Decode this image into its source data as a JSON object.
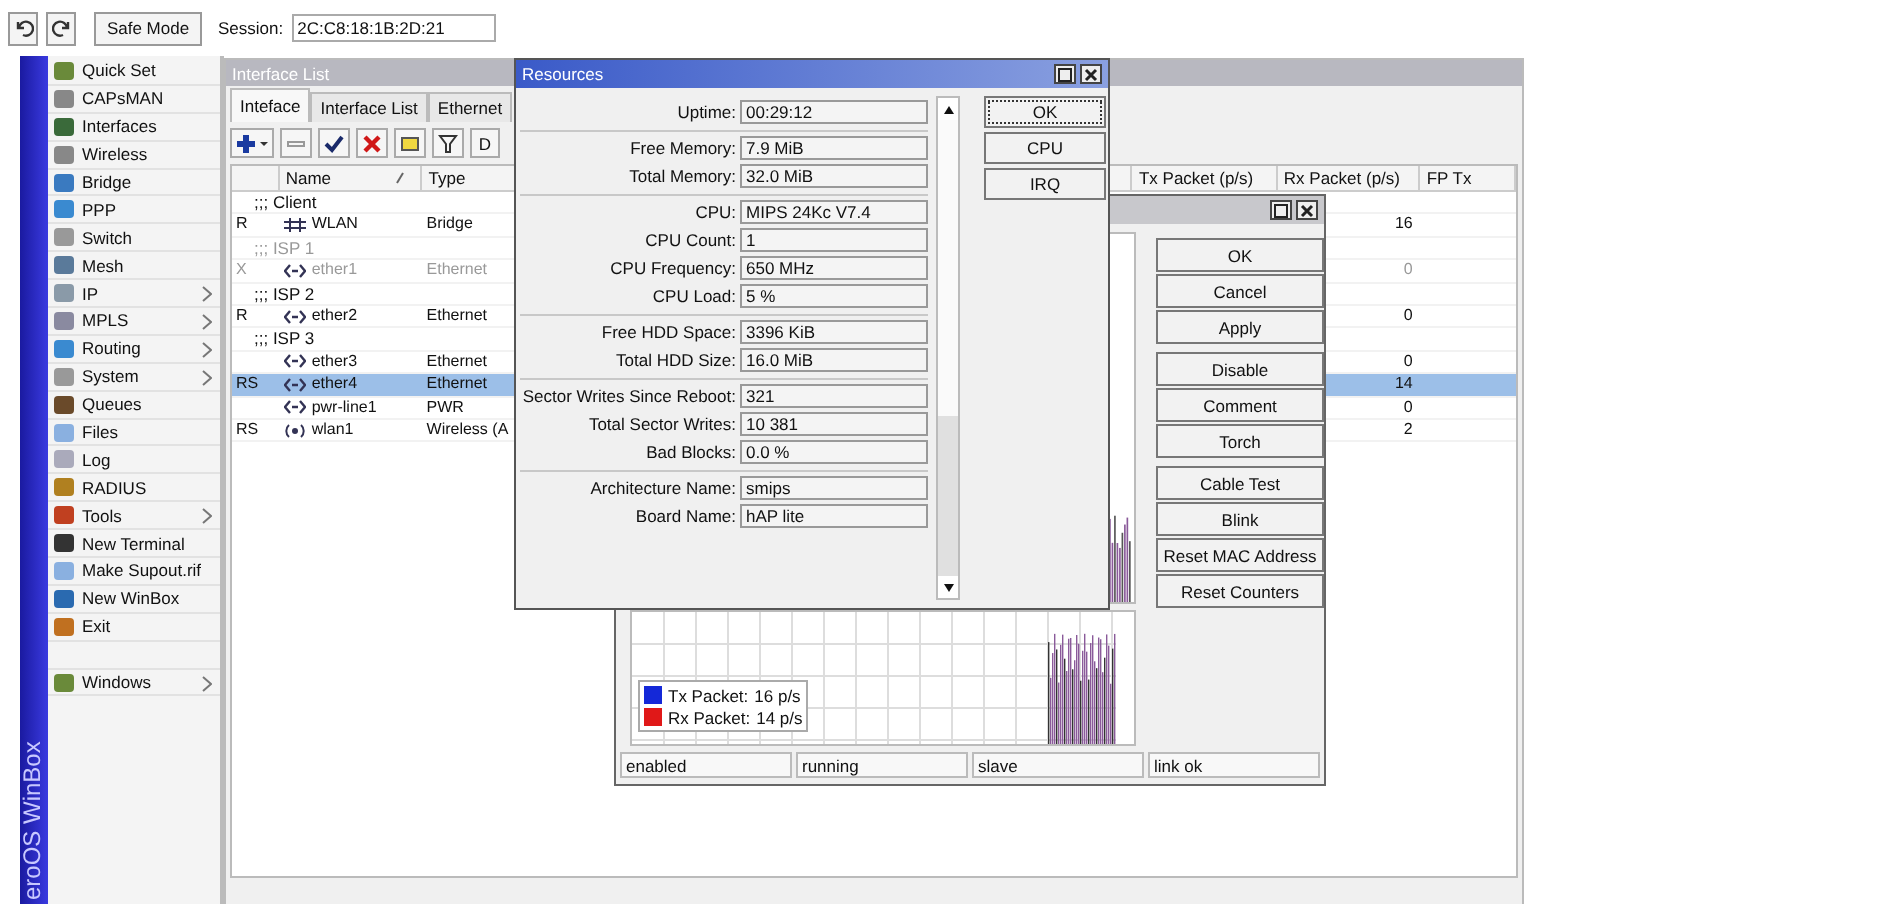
{
  "topbar": {
    "safe_mode": "Safe Mode",
    "session_label": "Session:",
    "session_value": "2C:C8:18:1B:2D:21"
  },
  "brand": "eroOS WinBox",
  "sidebar": {
    "items": [
      {
        "label": "Quick Set",
        "submenu": false
      },
      {
        "label": "CAPsMAN",
        "submenu": false
      },
      {
        "label": "Interfaces",
        "submenu": false
      },
      {
        "label": "Wireless",
        "submenu": false
      },
      {
        "label": "Bridge",
        "submenu": false
      },
      {
        "label": "PPP",
        "submenu": false
      },
      {
        "label": "Switch",
        "submenu": false
      },
      {
        "label": "Mesh",
        "submenu": false
      },
      {
        "label": "IP",
        "submenu": true
      },
      {
        "label": "MPLS",
        "submenu": true
      },
      {
        "label": "Routing",
        "submenu": true
      },
      {
        "label": "System",
        "submenu": true
      },
      {
        "label": "Queues",
        "submenu": false
      },
      {
        "label": "Files",
        "submenu": false
      },
      {
        "label": "Log",
        "submenu": false
      },
      {
        "label": "RADIUS",
        "submenu": false
      },
      {
        "label": "Tools",
        "submenu": true
      },
      {
        "label": "New Terminal",
        "submenu": false
      },
      {
        "label": "Make Supout.rif",
        "submenu": false
      },
      {
        "label": "New WinBox",
        "submenu": false
      },
      {
        "label": "Exit",
        "submenu": false
      },
      {
        "kind": "blank"
      },
      {
        "label": "Windows",
        "submenu": true
      }
    ]
  },
  "interface_list": {
    "title": "Interface List",
    "tabs": [
      {
        "label": "Inteface",
        "selected": true
      },
      {
        "label": "Interface List",
        "selected": false
      },
      {
        "label": "Ethernet",
        "selected": false
      }
    ],
    "toolbar": [
      {
        "kind": "add"
      },
      {
        "kind": "remove"
      },
      {
        "kind": "enable"
      },
      {
        "kind": "disable"
      },
      {
        "kind": "comment"
      },
      {
        "kind": "filter"
      },
      {
        "kind": "text",
        "label": "D"
      }
    ],
    "columns": [
      "Name",
      "Type",
      "Tx Packet (p/s)",
      "Rx Packet (p/s)",
      "FP Tx"
    ],
    "rows": [
      {
        "kind": "comment",
        "text": ";;; Client",
        "disabled": false
      },
      {
        "kind": "bridge",
        "flags": "R",
        "name": "WLAN",
        "type": "Bridge",
        "rx": "16",
        "disabled": false,
        "selected": false
      },
      {
        "kind": "comment",
        "text": ";;; ISP 1",
        "disabled": true
      },
      {
        "kind": "ether",
        "flags": "X",
        "name": "ether1",
        "type": "Ethernet",
        "rx": "0",
        "disabled": true,
        "selected": false
      },
      {
        "kind": "comment",
        "text": ";;; ISP 2",
        "disabled": false
      },
      {
        "kind": "ether",
        "flags": "R",
        "name": "ether2",
        "type": "Ethernet",
        "rx": "0",
        "disabled": false,
        "selected": false
      },
      {
        "kind": "comment",
        "text": ";;; ISP 3",
        "disabled": false
      },
      {
        "kind": "ether",
        "flags": "",
        "name": "ether3",
        "type": "Ethernet",
        "rx": "0",
        "disabled": false,
        "selected": false
      },
      {
        "kind": "ether",
        "flags": "RS",
        "name": "ether4",
        "type": "Ethernet",
        "rx": "14",
        "disabled": false,
        "selected": true
      },
      {
        "kind": "ether",
        "flags": "",
        "name": "pwr-line1",
        "type": "PWR",
        "rx": "0",
        "disabled": false,
        "selected": false
      },
      {
        "kind": "wireless",
        "flags": "RS",
        "name": "wlan1",
        "type": "Wireless (A",
        "rx": "2",
        "disabled": false,
        "selected": false
      }
    ]
  },
  "interface_window": {
    "buttons": [
      [
        "OK",
        "Cancel",
        "Apply"
      ],
      [
        "Disable",
        "Comment",
        "Torch"
      ],
      [
        "Cable Test",
        "Blink",
        "Reset MAC Address",
        "Reset Counters"
      ]
    ],
    "legend": [
      {
        "label": "Tx Packet:",
        "value": "16 p/s",
        "color": "#1428d8"
      },
      {
        "label": "Rx Packet:",
        "value": "14 p/s",
        "color": "#e01818"
      }
    ],
    "status": [
      "enabled",
      "running",
      "slave",
      "link ok"
    ]
  },
  "resources": {
    "title": "Resources",
    "groups": [
      [
        {
          "label": "Uptime:",
          "value": "00:29:12"
        }
      ],
      [
        {
          "label": "Free Memory:",
          "value": "7.9 MiB"
        },
        {
          "label": "Total Memory:",
          "value": "32.0 MiB"
        }
      ],
      [
        {
          "label": "CPU:",
          "value": "MIPS 24Kc V7.4"
        },
        {
          "label": "CPU Count:",
          "value": "1"
        },
        {
          "label": "CPU Frequency:",
          "value": "650 MHz"
        },
        {
          "label": "CPU Load:",
          "value": "5 %"
        }
      ],
      [
        {
          "label": "Free HDD Space:",
          "value": "3396 KiB"
        },
        {
          "label": "Total HDD Size:",
          "value": "16.0 MiB"
        }
      ],
      [
        {
          "label": "Sector Writes Since Reboot:",
          "value": "321"
        },
        {
          "label": "Total Sector Writes:",
          "value": "10 381"
        },
        {
          "label": "Bad Blocks:",
          "value": "0.0 %"
        }
      ],
      [
        {
          "label": "Architecture Name:",
          "value": "smips"
        },
        {
          "label": "Board Name:",
          "value": "hAP lite"
        }
      ]
    ],
    "buttons": [
      {
        "label": "OK",
        "focused": true
      },
      {
        "label": "CPU",
        "focused": false
      },
      {
        "label": "IRQ",
        "focused": false
      }
    ]
  }
}
